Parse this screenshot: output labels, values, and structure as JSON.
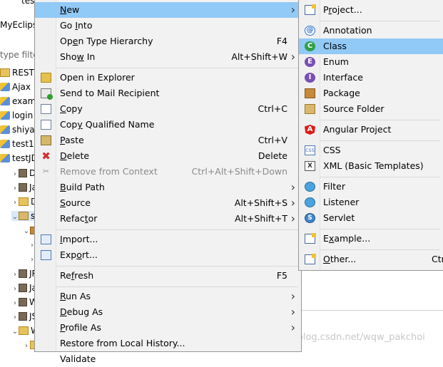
{
  "explorer": {
    "top_text": "test",
    "side_label": "MyEclips",
    "filter_label": "type filte",
    "items": [
      {
        "label": "REST",
        "tw": "",
        "icon": "folder-warning-icon"
      },
      {
        "label": "Ajax",
        "tw": "",
        "icon": "project-icon"
      },
      {
        "label": "exam",
        "tw": "",
        "icon": "project-icon"
      },
      {
        "label": "login",
        "tw": "",
        "icon": "project-icon"
      },
      {
        "label": "shiya",
        "tw": "",
        "icon": "project-icon"
      },
      {
        "label": "test1",
        "tw": "",
        "icon": "project-icon"
      },
      {
        "label": "testJD",
        "tw": "",
        "icon": "project-icon"
      },
      {
        "label": "D",
        "tw": ">",
        "icon": "jar-icon"
      },
      {
        "label": "Ja",
        "tw": ">",
        "icon": "library-icon"
      },
      {
        "label": "D",
        "tw": ">",
        "icon": "folder-icon"
      },
      {
        "label": "sr",
        "tw": "v",
        "icon": "source-folder-icon"
      },
      {
        "label": "",
        "tw": "v",
        "icon": "package-icon"
      },
      {
        "label": "",
        "tw": ">",
        "icon": ""
      },
      {
        "label": "",
        "tw": ">",
        "icon": ""
      },
      {
        "label": "JR",
        "tw": ">",
        "icon": "library-icon"
      },
      {
        "label": "Ja",
        "tw": ">",
        "icon": "library-icon"
      },
      {
        "label": "W",
        "tw": ">",
        "icon": "library-icon"
      },
      {
        "label": "JS",
        "tw": ">",
        "icon": "library-icon"
      },
      {
        "label": "W",
        "tw": "v",
        "icon": "folder-icon"
      },
      {
        "label": "",
        "tw": ">",
        "icon": "folder-icon"
      }
    ]
  },
  "context_menu": {
    "items": [
      {
        "label": "New",
        "mnemonic": "N",
        "submenu": true,
        "highlight": true,
        "icon": ""
      },
      {
        "label": "Go Into",
        "mnemonic": "I",
        "icon": ""
      },
      {
        "label": "Open Type Hierarchy",
        "mnemonic": "e",
        "shortcut": "F4",
        "icon": ""
      },
      {
        "label": "Show In",
        "mnemonic": "w",
        "shortcut": "Alt+Shift+W",
        "submenu": true,
        "icon": ""
      },
      {
        "sep": true
      },
      {
        "label": "Open in Explorer",
        "icon": "explorer"
      },
      {
        "label": "Send to Mail Recipient",
        "icon": "mail"
      },
      {
        "label": "Copy",
        "mnemonic": "C",
        "shortcut": "Ctrl+C",
        "icon": "copy"
      },
      {
        "label": "Copy Qualified Name",
        "mnemonic": "y",
        "icon": "copy"
      },
      {
        "label": "Paste",
        "mnemonic": "P",
        "shortcut": "Ctrl+V",
        "icon": "paste"
      },
      {
        "label": "Delete",
        "mnemonic": "D",
        "shortcut": "Delete",
        "icon": "delete"
      },
      {
        "label": "Remove from Context",
        "shortcut": "Ctrl+Alt+Shift+Down",
        "disabled": true,
        "icon": "removectx"
      },
      {
        "label": "Build Path",
        "mnemonic": "B",
        "submenu": true,
        "icon": ""
      },
      {
        "label": "Source",
        "mnemonic": "S",
        "shortcut": "Alt+Shift+S",
        "submenu": true,
        "icon": ""
      },
      {
        "label": "Refactor",
        "mnemonic": "t",
        "shortcut": "Alt+Shift+T",
        "submenu": true,
        "icon": ""
      },
      {
        "sep": true
      },
      {
        "label": "Import...",
        "mnemonic": "I",
        "icon": "import"
      },
      {
        "label": "Export...",
        "mnemonic": "o",
        "icon": "export"
      },
      {
        "sep": true
      },
      {
        "label": "Refresh",
        "mnemonic": "f",
        "shortcut": "F5",
        "icon": ""
      },
      {
        "sep": true
      },
      {
        "label": "Run As",
        "mnemonic": "R",
        "submenu": true,
        "icon": ""
      },
      {
        "label": "Debug As",
        "mnemonic": "D",
        "submenu": true,
        "icon": ""
      },
      {
        "label": "Profile As",
        "mnemonic": "P",
        "submenu": true,
        "icon": ""
      },
      {
        "label": "Restore from Local History...",
        "icon": ""
      },
      {
        "label": "Validate",
        "icon": ""
      }
    ]
  },
  "new_menu": {
    "items": [
      {
        "label": "Project...",
        "mnemonic": "r",
        "icon": "project"
      },
      {
        "sep": true
      },
      {
        "label": "Annotation",
        "icon": "annotation",
        "glyph": "@"
      },
      {
        "label": "Class",
        "icon": "class",
        "glyph": "C",
        "highlight": true
      },
      {
        "label": "Enum",
        "icon": "enum",
        "glyph": "E"
      },
      {
        "label": "Interface",
        "icon": "interface",
        "glyph": "I"
      },
      {
        "label": "Package",
        "icon": "package"
      },
      {
        "label": "Source Folder",
        "icon": "sourcefolder"
      },
      {
        "sep": true
      },
      {
        "label": "Angular Project",
        "icon": "angular",
        "glyph": "A"
      },
      {
        "sep": true
      },
      {
        "label": "CSS",
        "icon": "css",
        "glyph": "css"
      },
      {
        "label": "XML (Basic Templates)",
        "icon": "xml",
        "glyph": "X"
      },
      {
        "sep": true
      },
      {
        "label": "Filter",
        "icon": "filter"
      },
      {
        "label": "Listener",
        "icon": "listener"
      },
      {
        "label": "Servlet",
        "icon": "servlet",
        "glyph": "S"
      },
      {
        "sep": true
      },
      {
        "label": "Example...",
        "mnemonic": "x",
        "icon": "example"
      },
      {
        "sep": true
      },
      {
        "label": "Other...",
        "mnemonic": "O",
        "shortcut": "Ctr",
        "icon": "other"
      }
    ]
  },
  "watermark": "https://blog.csdn.net/wqw_pakchoi"
}
